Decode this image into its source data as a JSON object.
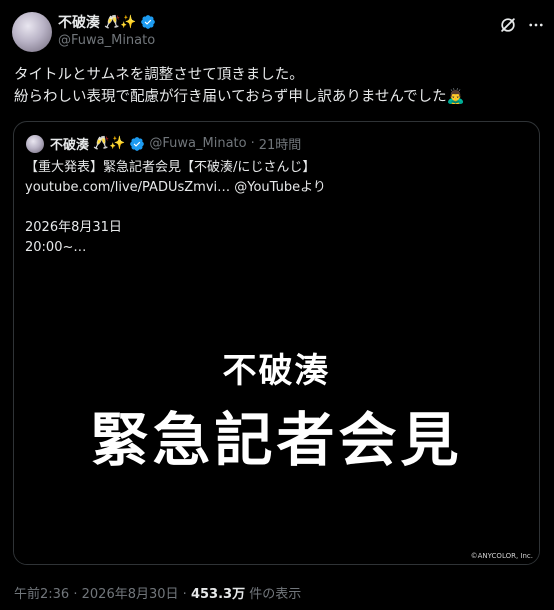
{
  "author": {
    "display_name": "不破湊",
    "name_emojis": "🥂✨",
    "handle": "@Fuwa_Minato"
  },
  "tweet": {
    "lines": [
      "タイトルとサムネを調整させて頂きました。",
      "紛らわしい表現で配慮が行き届いておらず申し訳ありませんでした🙇‍♂️"
    ]
  },
  "quote": {
    "display_name": "不破湊",
    "name_emojis": "🥂✨",
    "handle": "@Fuwa_Minato",
    "separator": "·",
    "time": "21時間",
    "lines": [
      "【重大発表】緊急記者会見【不破湊/にじさんじ】",
      "youtube.com/live/PADUsZmvi… @YouTubeより",
      "",
      "2026年8月31日",
      "20:00~…"
    ],
    "thumbnail": {
      "subtitle": "不破湊",
      "title": "緊急記者会見",
      "copyright": "©ANYCOLOR, Inc."
    }
  },
  "footer": {
    "time": "午前2:36",
    "separator": "·",
    "date": "2026年8月30日",
    "separator2": "·",
    "views": "453.3万",
    "views_label": "件の表示"
  },
  "colors": {
    "background": "#000000",
    "text": "#e7e9ea",
    "muted": "#71767b",
    "border": "#2f3336",
    "verified": "#1d9bf0"
  },
  "icons": {
    "verified": "verified-badge-icon",
    "grok": "grok-icon",
    "more": "more-icon"
  }
}
